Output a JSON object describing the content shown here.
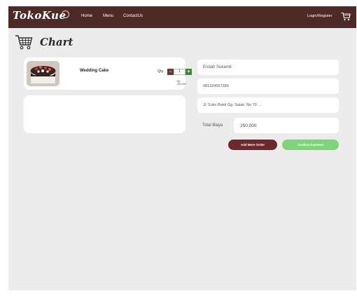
{
  "nav": {
    "logo": "TokoKue",
    "links": [
      "Home",
      "Menu",
      "ContactUs"
    ],
    "login": "Login/Register",
    "cart_icon": "cart-icon"
  },
  "page": {
    "title": "Chart",
    "icon": "shopping-cart-icon"
  },
  "cart_items": [
    {
      "name": "Wedding Cake",
      "qty_label": "Qty",
      "qty": "1",
      "minus": "-",
      "plus": "+",
      "price": "Rp 250.000"
    }
  ],
  "form": {
    "name": "Endah Sukamti",
    "phone": "081324567389",
    "address": "Jl. Suko Bakti Gg. Salak. No 70 ...",
    "total_label": "Total Biaya",
    "total_value": "250.000"
  },
  "buttons": {
    "add_more": "Add More Order",
    "confirm": "Confirm Payment"
  },
  "colors": {
    "navbar": "#4e2a27",
    "background": "#ececec",
    "add_button": "#6d2a2b",
    "confirm_button": "#7ed478"
  }
}
